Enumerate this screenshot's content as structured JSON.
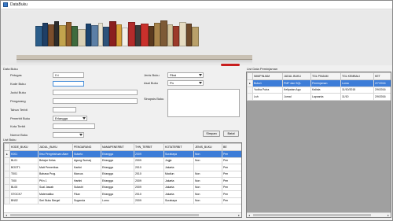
{
  "window": {
    "title": "DataBuku"
  },
  "form": {
    "title": "Data Buku",
    "labels": {
      "peminjam": "Petugas",
      "kode": "Kode Buku",
      "judul": "Judul Buku",
      "pengarang": "Pengarang",
      "tahun": "Tahun Terbit",
      "penerbit": "Penerbit Buku",
      "kota": "Kota Terbit",
      "nomor_rak": "Nomor Buku",
      "jenis": "Jenis Buku",
      "asal": "Asal Buku",
      "sinopsis": "Sinopsis Buku"
    },
    "values": {
      "petugas": "Eri",
      "penerbit": "Erlangga",
      "jenis": "Fiksi",
      "asal": "Pn"
    },
    "buttons": {
      "simpan": "Simpan",
      "batal": "Batal"
    }
  },
  "grid_left": {
    "title": "List Buku",
    "columns": [
      "KODE_BUKU",
      "JUDUL_BUKU",
      "PENGARANG",
      "NAMAPENERBIT",
      "THN_TERBIT",
      "KOTATERBIT",
      "JENIS_BUKU",
      "BE"
    ],
    "rows": [
      [
        "K001",
        "Ilmu Pengetahuan Alam",
        "Sutarto",
        "Erlangga",
        "2009",
        "Surabaya",
        "Non",
        "Pen"
      ],
      [
        "BL01",
        "Belajar Kelas",
        "Agung Sumarj",
        "Erlangga",
        "2009",
        "Jogja",
        "Non",
        "Pen"
      ],
      [
        "BOOT1",
        "Matt Pemeriksa",
        "Kartini",
        "Erlangga",
        "2010",
        "Jakarta",
        "",
        "Pen"
      ],
      [
        "T001",
        "Bahasa Prog.",
        "Marcus",
        "Erlangga",
        "2010",
        "Madiun",
        "Non",
        "Pen"
      ],
      [
        "TI00",
        "PKn 1",
        "Hartini",
        "Erlangga",
        "2009",
        "Jakarta",
        "Non",
        "Pen"
      ],
      [
        "BL05",
        "Soal Jawab",
        "Sulastri",
        "Erlangga",
        "2009",
        "Jakarta",
        "Non",
        "Pen"
      ],
      [
        "STOCK7",
        "Matematika",
        "Fikar",
        "Erlangga",
        "2010",
        "Jakarta",
        "Non",
        "Pen"
      ],
      [
        "BN02",
        "Seri Buku Bergel",
        "Suganda",
        "Lomo",
        "2009",
        "Surabaya",
        "Non",
        "Pen"
      ]
    ]
  },
  "grid_right": {
    "title": "List Data Peminjaman",
    "columns": [
      "NIM/PINJAM",
      "JUDUL BUKU",
      "TGL PINJAM",
      "TGL KEMBALI",
      "KET"
    ],
    "rows": [
      [
        "Buku1",
        "PMF dan SQL",
        "Peminjaman",
        "Loma",
        "2/7/2016"
      ],
      [
        "Yudha Putra",
        "Kelipatan Agu",
        "Kalista",
        "11/10/2015",
        "2/9/2016"
      ],
      [
        "Lsh",
        "Jurnal",
        "Lapsanta",
        "11/10",
        "2/9/2016"
      ]
    ]
  },
  "colors": {
    "accent": "#3d7dd8",
    "shelf": "#c9c1b4",
    "window": "#f0f0f0"
  }
}
